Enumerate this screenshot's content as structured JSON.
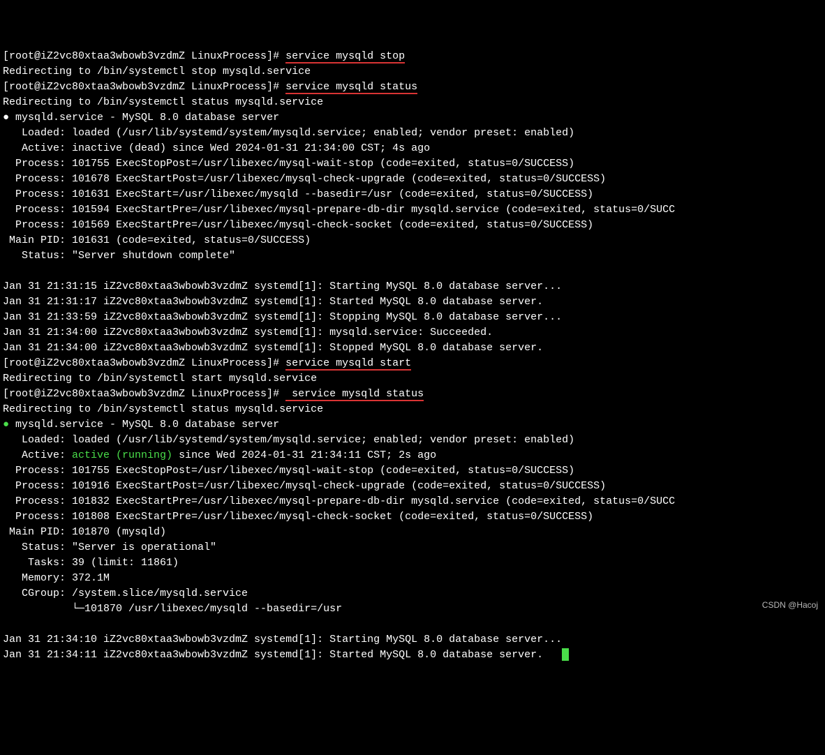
{
  "prompt1": "[root@iZ2vc80xtaa3wbowb3vzdmZ LinuxProcess]# ",
  "cmd_stop": "service mysqld stop",
  "redir_stop": "Redirecting to /bin/systemctl stop mysqld.service",
  "prompt2": "[root@iZ2vc80xtaa3wbowb3vzdmZ LinuxProcess]# ",
  "cmd_status1": "service mysqld status",
  "redir_status1": "Redirecting to /bin/systemctl status mysqld.service",
  "bullet1": "●",
  "svc_line1": " mysqld.service - MySQL 8.0 database server",
  "loaded1": "   Loaded: loaded (/usr/lib/systemd/system/mysqld.service; enabled; vendor preset: enabled)",
  "active1": "   Active: inactive (dead) since Wed 2024-01-31 21:34:00 CST; 4s ago",
  "proc1a": "  Process: 101755 ExecStopPost=/usr/libexec/mysql-wait-stop (code=exited, status=0/SUCCESS)",
  "proc1b": "  Process: 101678 ExecStartPost=/usr/libexec/mysql-check-upgrade (code=exited, status=0/SUCCESS)",
  "proc1c": "  Process: 101631 ExecStart=/usr/libexec/mysqld --basedir=/usr (code=exited, status=0/SUCCESS)",
  "proc1d": "  Process: 101594 ExecStartPre=/usr/libexec/mysql-prepare-db-dir mysqld.service (code=exited, status=0/SUCC",
  "proc1e": "  Process: 101569 ExecStartPre=/usr/libexec/mysql-check-socket (code=exited, status=0/SUCCESS)",
  "mainpid1": " Main PID: 101631 (code=exited, status=0/SUCCESS)",
  "status_txt1": "   Status: \"Server shutdown complete\"",
  "blank": " ",
  "log1a": "Jan 31 21:31:15 iZ2vc80xtaa3wbowb3vzdmZ systemd[1]: Starting MySQL 8.0 database server...",
  "log1b": "Jan 31 21:31:17 iZ2vc80xtaa3wbowb3vzdmZ systemd[1]: Started MySQL 8.0 database server.",
  "log1c": "Jan 31 21:33:59 iZ2vc80xtaa3wbowb3vzdmZ systemd[1]: Stopping MySQL 8.0 database server...",
  "log1d": "Jan 31 21:34:00 iZ2vc80xtaa3wbowb3vzdmZ systemd[1]: mysqld.service: Succeeded.",
  "log1e": "Jan 31 21:34:00 iZ2vc80xtaa3wbowb3vzdmZ systemd[1]: Stopped MySQL 8.0 database server.",
  "prompt3": "[root@iZ2vc80xtaa3wbowb3vzdmZ LinuxProcess]# ",
  "cmd_start": "service mysqld start",
  "redir_start": "Redirecting to /bin/systemctl start mysqld.service",
  "prompt4": "[root@iZ2vc80xtaa3wbowb3vzdmZ LinuxProcess]# ",
  "cmd_status2": " service mysqld status",
  "redir_status2": "Redirecting to /bin/systemctl status mysqld.service",
  "bullet2": "●",
  "svc_line2": " mysqld.service - MySQL 8.0 database server",
  "loaded2": "   Loaded: loaded (/usr/lib/systemd/system/mysqld.service; enabled; vendor preset: enabled)",
  "active2_label": "   Active: ",
  "active2_state": "active (running)",
  "active2_rest": " since Wed 2024-01-31 21:34:11 CST; 2s ago",
  "proc2a": "  Process: 101755 ExecStopPost=/usr/libexec/mysql-wait-stop (code=exited, status=0/SUCCESS)",
  "proc2b": "  Process: 101916 ExecStartPost=/usr/libexec/mysql-check-upgrade (code=exited, status=0/SUCCESS)",
  "proc2c": "  Process: 101832 ExecStartPre=/usr/libexec/mysql-prepare-db-dir mysqld.service (code=exited, status=0/SUCC",
  "proc2d": "  Process: 101808 ExecStartPre=/usr/libexec/mysql-check-socket (code=exited, status=0/SUCCESS)",
  "mainpid2": " Main PID: 101870 (mysqld)",
  "status_txt2": "   Status: \"Server is operational\"",
  "tasks2": "    Tasks: 39 (limit: 11861)",
  "memory2": "   Memory: 372.1M",
  "cgroup2": "   CGroup: /system.slice/mysqld.service",
  "cgroup2_child": "           └─101870 /usr/libexec/mysqld --basedir=/usr",
  "log2a": "Jan 31 21:34:10 iZ2vc80xtaa3wbowb3vzdmZ systemd[1]: Starting MySQL 8.0 database server...",
  "log2b": "Jan 31 21:34:11 iZ2vc80xtaa3wbowb3vzdmZ systemd[1]: Started MySQL 8.0 database server.",
  "watermark": "CSDN @Hacoj"
}
